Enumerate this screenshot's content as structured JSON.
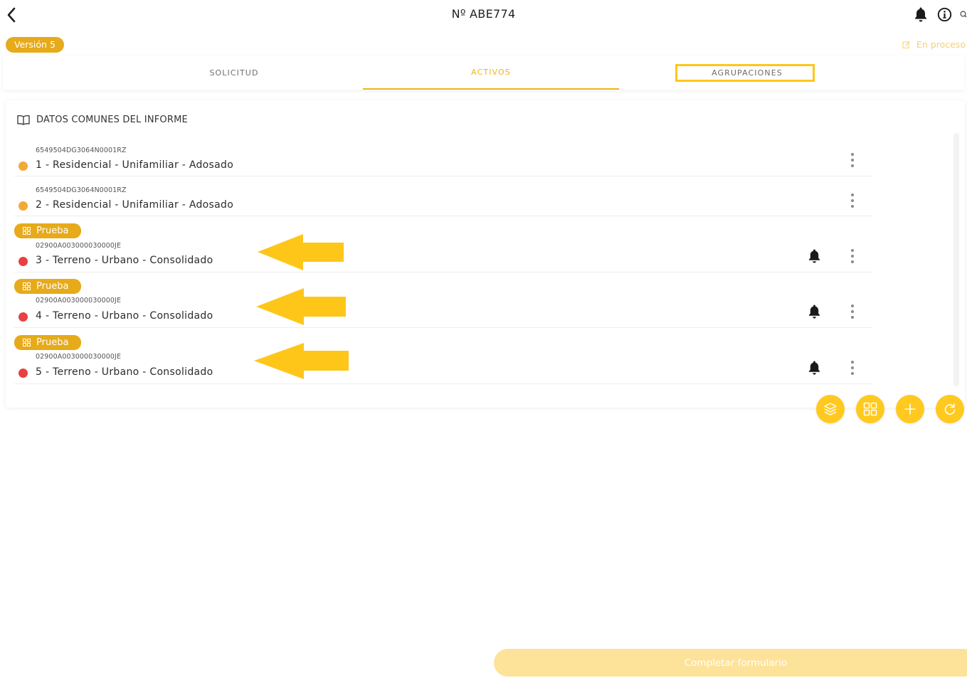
{
  "header": {
    "title": "Nº ABE774",
    "icons": [
      "back-icon",
      "bell-icon",
      "info-icon",
      "search-icon"
    ]
  },
  "version_label": "Versión 5",
  "status_label": "En proceso",
  "tabs": [
    {
      "label": "SOLICITUD",
      "active": false
    },
    {
      "label": "ACTIVOS",
      "active": true
    },
    {
      "label": "AGRUPACIONES",
      "active": false
    }
  ],
  "section_title": "DATOS COMUNES DEL INFORME",
  "items": [
    {
      "ref": "6549504DG3064N0001RZ",
      "title": "1 - Residencial - Unifamiliar - Adosado",
      "status_color": "#f3a935",
      "group": "",
      "alert": false
    },
    {
      "ref": "6549504DG3064N0001RZ",
      "title": "2 - Residencial - Unifamiliar - Adosado",
      "status_color": "#f3a935",
      "group": "",
      "alert": false
    },
    {
      "ref": "02900A003000030000JE",
      "title": "3 - Terreno - Urbano - Consolidado",
      "status_color": "#e84141",
      "group": "Prueba",
      "alert": true
    },
    {
      "ref": "02900A003000030000JE",
      "title": "4 - Terreno - Urbano - Consolidado",
      "status_color": "#e84141",
      "group": "Prueba",
      "alert": true
    },
    {
      "ref": "02900A003000030000JE",
      "title": "5 - Terreno - Urbano - Consolidado",
      "status_color": "#e84141",
      "group": "Prueba",
      "alert": true
    }
  ],
  "fabs": [
    "layers-icon",
    "grid-icon",
    "plus-icon",
    "refresh-icon"
  ],
  "complete_label": "Completar formulario",
  "colors": {
    "accent": "#f0b41c",
    "badge": "#e6aa1a",
    "fab": "#ffc91f",
    "annotation": "#ffc61a",
    "complete_disabled": "#fde29a"
  }
}
